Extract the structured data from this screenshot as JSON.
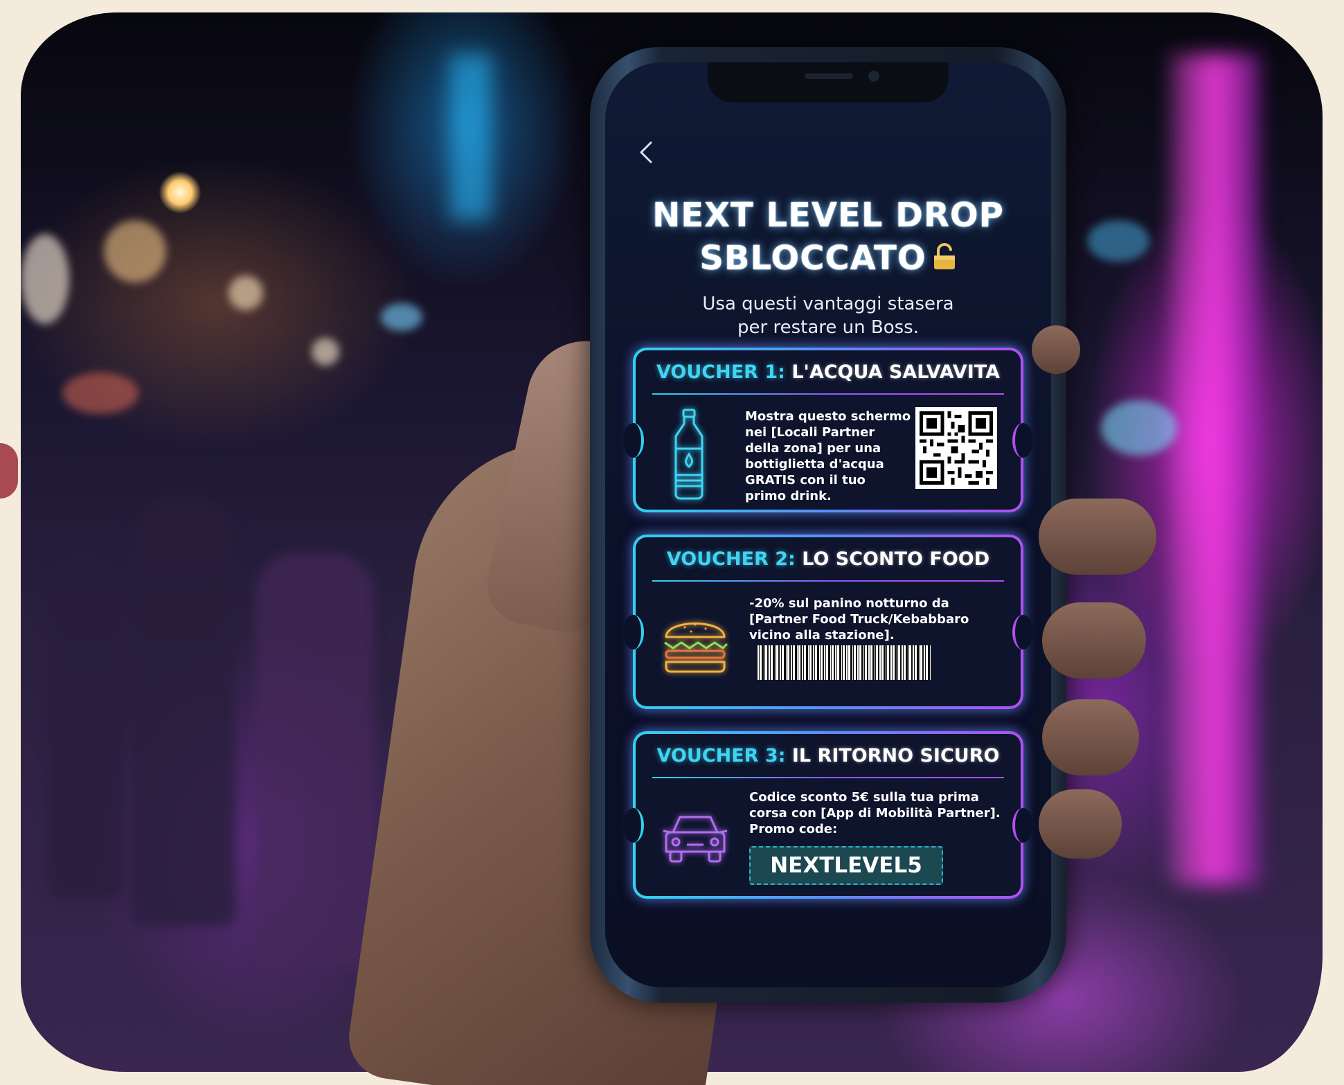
{
  "screen": {
    "title_line1": "NEXT LEVEL DROP",
    "title_line2": "SBLOCCATO",
    "subtitle_line1": "Usa questi vantaggi stasera",
    "subtitle_line2": "per restare un Boss."
  },
  "vouchers": [
    {
      "lead": "VOUCHER 1:",
      "title": "L'ACQUA SALVAVITA",
      "text": [
        "Mostra questo schermo",
        "nei [Locali Partner",
        "della zona] per una",
        "bottiglietta d'acqua",
        "GRATIS con il tuo",
        "primo drink."
      ],
      "icon": "water-bottle-icon",
      "code_type": "qr-code"
    },
    {
      "lead": "VOUCHER 2:",
      "title": "LO SCONTO FOOD",
      "text": [
        "-20% sul panino notturno da",
        "[Partner Food Truck/Kebabbaro",
        "vicino alla stazione]."
      ],
      "icon": "burger-icon",
      "code_type": "barcode"
    },
    {
      "lead": "VOUCHER 3:",
      "title": "IL RITORNO SICURO",
      "text": [
        "Codice sconto 5€ sulla tua prima",
        "corsa con [App di Mobilità Partner].",
        "Promo code:"
      ],
      "icon": "car-icon",
      "promo_code": "NEXTLEVEL5"
    }
  ],
  "colors": {
    "accent_cyan": "#2fd3f0",
    "accent_purple": "#b24ef2",
    "screen_bg": "#0b1128"
  }
}
